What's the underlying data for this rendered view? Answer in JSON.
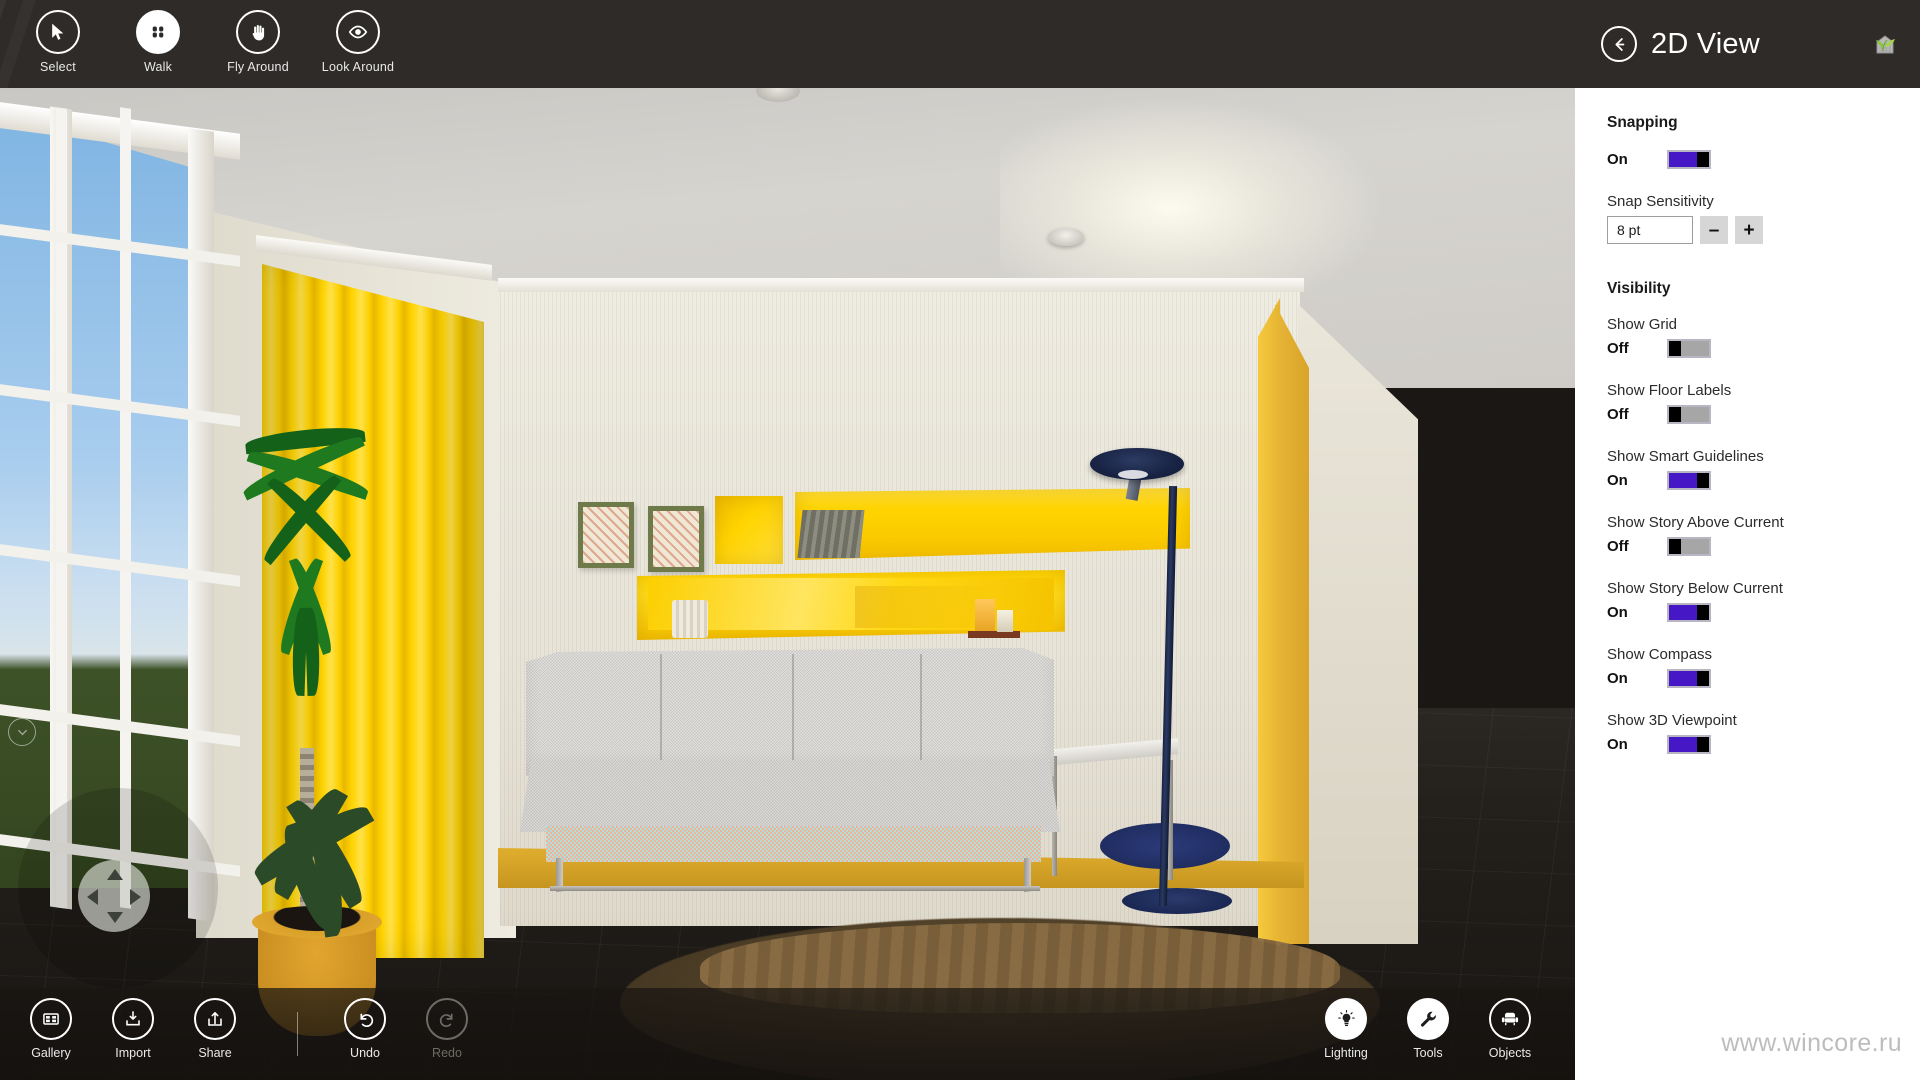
{
  "app": {
    "window_title": "2D View",
    "app_icon": "plant-house-icon",
    "watermark": "www.wincore.ru"
  },
  "top_toolbar": {
    "items": [
      {
        "label": "Select",
        "icon": "cursor-arrow-icon",
        "active": false
      },
      {
        "label": "Walk",
        "icon": "footprints-icon",
        "active": true
      },
      {
        "label": "Fly Around",
        "icon": "hand-icon",
        "active": false
      },
      {
        "label": "Look Around",
        "icon": "eye-icon",
        "active": false
      }
    ]
  },
  "bottom_toolbar": {
    "left_items": [
      {
        "label": "Gallery",
        "icon": "gallery-grid-icon",
        "enabled": true
      },
      {
        "label": "Import",
        "icon": "download-box-icon",
        "enabled": true
      },
      {
        "label": "Share",
        "icon": "share-upload-icon",
        "enabled": true
      },
      {
        "label": "Undo",
        "icon": "undo-arrow-icon",
        "enabled": true
      },
      {
        "label": "Redo",
        "icon": "redo-arrow-icon",
        "enabled": false
      }
    ],
    "right_items": [
      {
        "label": "Lighting",
        "icon": "lightbulb-icon",
        "active": true
      },
      {
        "label": "Tools",
        "icon": "wrench-icon",
        "active": true
      },
      {
        "label": "Objects",
        "icon": "armchair-icon",
        "active": false
      }
    ]
  },
  "panel": {
    "title": "2D View",
    "back_button": "back-arrow-icon",
    "sections": [
      {
        "title": "Snapping",
        "toggle": {
          "label": "",
          "state": "On",
          "on": true
        },
        "stepper": {
          "label": "Snap Sensitivity",
          "value": "8 pt",
          "minus": "–",
          "plus": "+"
        }
      },
      {
        "title": "Visibility",
        "items": [
          {
            "label": "Show Grid",
            "state": "Off",
            "on": false
          },
          {
            "label": "Show Floor Labels",
            "state": "Off",
            "on": false
          },
          {
            "label": "Show Smart Guidelines",
            "state": "On",
            "on": true
          },
          {
            "label": "Show Story Above Current",
            "state": "Off",
            "on": false
          },
          {
            "label": "Show Story Below Current",
            "state": "On",
            "on": true
          },
          {
            "label": "Show Compass",
            "state": "On",
            "on": true
          },
          {
            "label": "Show 3D Viewpoint",
            "state": "On",
            "on": true
          }
        ]
      }
    ]
  },
  "viewport": {
    "scene_description": "3D interior rendering of a living room with yellow curtains, white grid window, grey sofa, yellow wall niches, floor lamp and potted palms",
    "nav_widget": {
      "up": "nav-up-arrow",
      "down": "nav-down-arrow",
      "left": "nav-left-arrow",
      "right": "nav-right-arrow",
      "expand": "chevron-down-icon"
    }
  },
  "colors": {
    "toggle_on": "#4617c4",
    "toggle_off": "#a6a6a6",
    "chrome_dark": "#2e2b28",
    "panel_bg": "#ffffff",
    "accent_yellow": "#ffd400"
  }
}
